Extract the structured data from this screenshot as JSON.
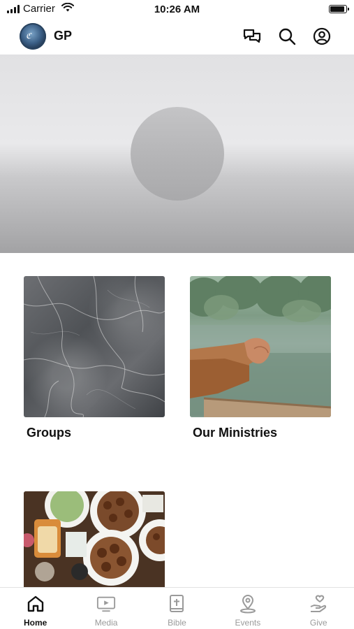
{
  "status_bar": {
    "carrier": "Carrier",
    "time": "10:26 AM",
    "battery_level": 0.95
  },
  "header": {
    "title": "GP",
    "icons": [
      "chat-icon",
      "search-icon",
      "profile-icon"
    ]
  },
  "cards": [
    {
      "label": "Groups",
      "image": "marble-texture"
    },
    {
      "label": "Our Ministries",
      "image": "hands-on-railing-lake"
    },
    {
      "label": "",
      "image": "food-table"
    }
  ],
  "tabs": [
    {
      "label": "Home",
      "icon": "home-icon",
      "active": true
    },
    {
      "label": "Media",
      "icon": "media-icon",
      "active": false
    },
    {
      "label": "Bible",
      "icon": "bible-icon",
      "active": false
    },
    {
      "label": "Events",
      "icon": "location-icon",
      "active": false
    },
    {
      "label": "Give",
      "icon": "give-icon",
      "active": false
    }
  ],
  "colors": {
    "active_tab": "#111111",
    "inactive_tab": "#9a9a9a"
  }
}
